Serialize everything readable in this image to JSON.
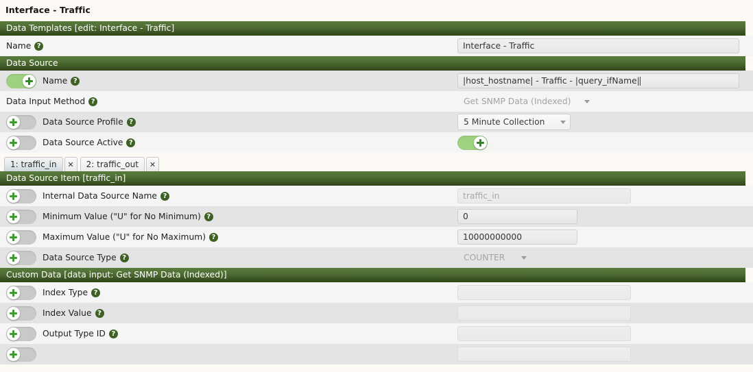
{
  "page": {
    "title": "Interface - Traffic"
  },
  "icons": {
    "help": "?",
    "close": "✕"
  },
  "sections": {
    "data_templates": {
      "header": "Data Templates [edit: Interface - Traffic]",
      "rows": [
        {
          "label": "Name",
          "has_toggle": false,
          "value": "Interface - Traffic",
          "field": "textbox-wide",
          "disabled": false,
          "caret": false
        }
      ]
    },
    "data_source": {
      "header": "Data Source",
      "rows": [
        {
          "label": "Name",
          "has_toggle": true,
          "toggle_state": "on",
          "value": "|host_hostname| - Traffic - |query_ifName|",
          "field": "textbox-wide",
          "disabled": false,
          "caret": true
        },
        {
          "label": "Data Input Method",
          "has_toggle": false,
          "value": "Get SNMP Data (Indexed)",
          "field": "select-input",
          "disabled": true,
          "caret": false
        },
        {
          "label": "Data Source Profile",
          "has_toggle": true,
          "toggle_state": "off",
          "value": "5 Minute Collection",
          "field": "select-profile",
          "disabled": false,
          "caret": false
        },
        {
          "label": "Data Source Active",
          "has_toggle": true,
          "toggle_state": "off",
          "value": "",
          "field": "toggle-on",
          "disabled": false,
          "caret": false
        }
      ]
    },
    "tabs": [
      {
        "label": "1: traffic_in",
        "active": true
      },
      {
        "label": "2: traffic_out",
        "active": false
      }
    ],
    "data_source_item": {
      "header": "Data Source Item [traffic_in]",
      "rows": [
        {
          "label": "Internal Data Source Name",
          "has_toggle": true,
          "toggle_state": "off",
          "value": "traffic_in",
          "field": "textbox-narrow",
          "disabled": true,
          "caret": false
        },
        {
          "label": "Minimum Value (\"U\" for No Minimum)",
          "has_toggle": true,
          "toggle_state": "off",
          "value": "0",
          "field": "textbox-medium",
          "disabled": false,
          "caret": false
        },
        {
          "label": "Maximum Value (\"U\" for No Maximum)",
          "has_toggle": true,
          "toggle_state": "off",
          "value": "10000000000",
          "field": "textbox-medium",
          "disabled": false,
          "caret": false
        },
        {
          "label": "Data Source Type",
          "has_toggle": true,
          "toggle_state": "off",
          "value": "COUNTER",
          "field": "select-type",
          "disabled": true,
          "caret": false
        }
      ]
    },
    "custom_data": {
      "header": "Custom Data [data input: Get SNMP Data (Indexed)]",
      "rows": [
        {
          "label": "Index Type",
          "has_toggle": true,
          "toggle_state": "off",
          "value": "",
          "field": "textbox-narrow",
          "disabled": true,
          "caret": false
        },
        {
          "label": "Index Value",
          "has_toggle": true,
          "toggle_state": "off",
          "value": "",
          "field": "textbox-narrow",
          "disabled": true,
          "caret": false
        },
        {
          "label": "Output Type ID",
          "has_toggle": true,
          "toggle_state": "off",
          "value": "",
          "field": "textbox-narrow",
          "disabled": true,
          "caret": false
        },
        {
          "label": "",
          "has_toggle": true,
          "toggle_state": "off",
          "value": "",
          "field": "textbox-narrow",
          "disabled": true,
          "caret": false,
          "partial": true
        }
      ]
    }
  },
  "colors": {
    "header_green_top": "#5a7b3c",
    "header_green_bottom": "#2f4417",
    "toggle_on": "#9fd183",
    "toggle_off": "#c9c9c9",
    "help_icon": "#3e6123",
    "page_background": "#fdfaf6",
    "row_odd": "#f5f5f5",
    "row_even": "#e4e4e4"
  }
}
